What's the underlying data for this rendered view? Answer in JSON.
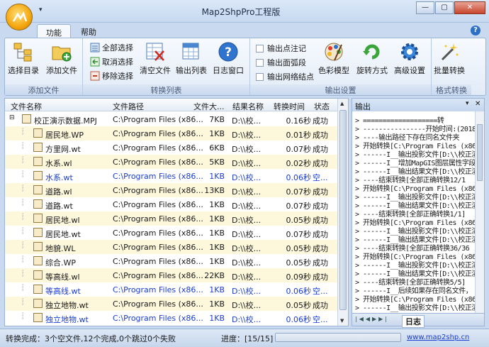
{
  "window": {
    "title": "Map2ShpPro工程版",
    "qat": "▾",
    "min": "—",
    "max": "▢",
    "close": "✕"
  },
  "tabs": [
    {
      "label": "功能"
    },
    {
      "label": "帮助"
    }
  ],
  "help_icon": "?",
  "ribbon": {
    "add_files": {
      "label": "添加文件",
      "select_dir": "选择目录",
      "add_file": "添加文件"
    },
    "convert_list": {
      "label": "转换列表",
      "select_all": "全部选择",
      "deselect": "取消选择",
      "remove": "移除选择",
      "clear": "清空文件",
      "output_list": "输出列表",
      "log_window": "日志窗口"
    },
    "output_settings": {
      "label": "输出设置",
      "opt_points": "输出点注记",
      "opt_arcs": "输出面弧段",
      "opt_nodes": "输出网络结点",
      "color_model": "色彩模型",
      "rotate": "旋转方式",
      "advanced": "高级设置"
    },
    "format_convert": {
      "label": "格式转换",
      "batch": "批量转换"
    }
  },
  "table": {
    "columns": [
      "文件名称",
      "文件路径",
      "文件大...",
      "结果名称",
      "转换时间",
      "状态"
    ],
    "rows": [
      {
        "name": "校正演示数据.MPJ",
        "path": "C:\\Program Files (x86...",
        "size": "7KB",
        "result": "D:\\\\校...",
        "time": "0.16秒",
        "status": "成功"
      },
      {
        "name": "居民地.WP",
        "path": "C:\\Program Files (x86...",
        "size": "1KB",
        "result": "D:\\\\校...",
        "time": "0.01秒",
        "status": "成功"
      },
      {
        "name": "方里网.wt",
        "path": "C:\\Program Files (x86...",
        "size": "6KB",
        "result": "D:\\\\校...",
        "time": "0.07秒",
        "status": "成功"
      },
      {
        "name": "水系.wl",
        "path": "C:\\Program Files (x86...",
        "size": "5KB",
        "result": "D:\\\\校...",
        "time": "0.02秒",
        "status": "成功"
      },
      {
        "name": "水系.wt",
        "path": "C:\\Program Files (x86...",
        "size": "1KB",
        "result": "D:\\\\校...",
        "time": "0.06秒",
        "status": "空..."
      },
      {
        "name": "道路.wl",
        "path": "C:\\Program Files (x86...",
        "size": "13KB",
        "result": "D:\\\\校...",
        "time": "0.07秒",
        "status": "成功"
      },
      {
        "name": "道路.wt",
        "path": "C:\\Program Files (x86...",
        "size": "1KB",
        "result": "D:\\\\校...",
        "time": "0.07秒",
        "status": "成功"
      },
      {
        "name": "居民地.wl",
        "path": "C:\\Program Files (x86...",
        "size": "1KB",
        "result": "D:\\\\校...",
        "time": "0.05秒",
        "status": "成功"
      },
      {
        "name": "居民地.wt",
        "path": "C:\\Program Files (x86...",
        "size": "1KB",
        "result": "D:\\\\校...",
        "time": "0.07秒",
        "status": "成功"
      },
      {
        "name": "地貌.WL",
        "path": "C:\\Program Files (x86...",
        "size": "1KB",
        "result": "D:\\\\校...",
        "time": "0.05秒",
        "status": "成功"
      },
      {
        "name": "综合.WP",
        "path": "C:\\Program Files (x86...",
        "size": "1KB",
        "result": "D:\\\\校...",
        "time": "0.05秒",
        "status": "成功"
      },
      {
        "name": "等高线.wl",
        "path": "C:\\Program Files (x86...",
        "size": "22KB",
        "result": "D:\\\\校...",
        "time": "0.09秒",
        "status": "成功"
      },
      {
        "name": "等高线.wt",
        "path": "C:\\Program Files (x86...",
        "size": "1KB",
        "result": "D:\\\\校...",
        "time": "0.06秒",
        "status": "空..."
      },
      {
        "name": "独立地物.wt",
        "path": "C:\\Program Files (x86...",
        "size": "1KB",
        "result": "D:\\\\校...",
        "time": "0.05秒",
        "status": "成功"
      },
      {
        "name": "独立地物.wt",
        "path": "C:\\Program Files (x86...",
        "size": "1KB",
        "result": "D:\\\\校...",
        "time": "0.06秒",
        "status": "空..."
      }
    ]
  },
  "output": {
    "title": "输出",
    "pin": "✕",
    "tab": "日志",
    "lines": [
      "> ===================转",
      "> ----------------开始时间:(2018-0",
      "> ----输出路径下存在同名文件夹",
      "> 开始转换[C:\\Program Files (x86)\\",
      "> ------I__输出投影文件[D:\\\\校正演",
      "> ------I__增加MapGIS图层属性字段",
      "> ------I__输出结果文件[D:\\\\校正演",
      "> ----结束转换[全部正确转换12/1",
      "> 开始转换[C:\\Program Files (x86)\\",
      "> ------I__输出投影文件[D:\\\\校正演",
      "> ------I__输出结果文件[D:\\\\校正演",
      "> ----结束转换[全部正确转换1/1]",
      "> 开始转换[C:\\Program Files (x86)\\",
      "> ------I__输出投影文件[D:\\\\校正演",
      "> ------I__输出结果文件[D:\\\\校正演",
      "> ----结束转换[全部正确转换36/36",
      "> 开始转换[C:\\Program Files (x86)\\",
      "> ------I__输出投影文件[D:\\\\校正演",
      "> ------I__输出结果文件[D:\\\\校正演",
      "> ----结束转换[全部正确转换5/5]",
      "> ------I__后续如果存在同名文件，",
      "> 开始转换[C:\\Program Files (x86)\\",
      "> ------I__输出投影文件[D:\\\\校正演"
    ]
  },
  "status": {
    "summary": "转换完成：3个空文件,12个完成,0个跳过0个失败",
    "progress_label": "进度：[15/15]",
    "progress": 1.0,
    "link": "www.map2shp.cn"
  }
}
